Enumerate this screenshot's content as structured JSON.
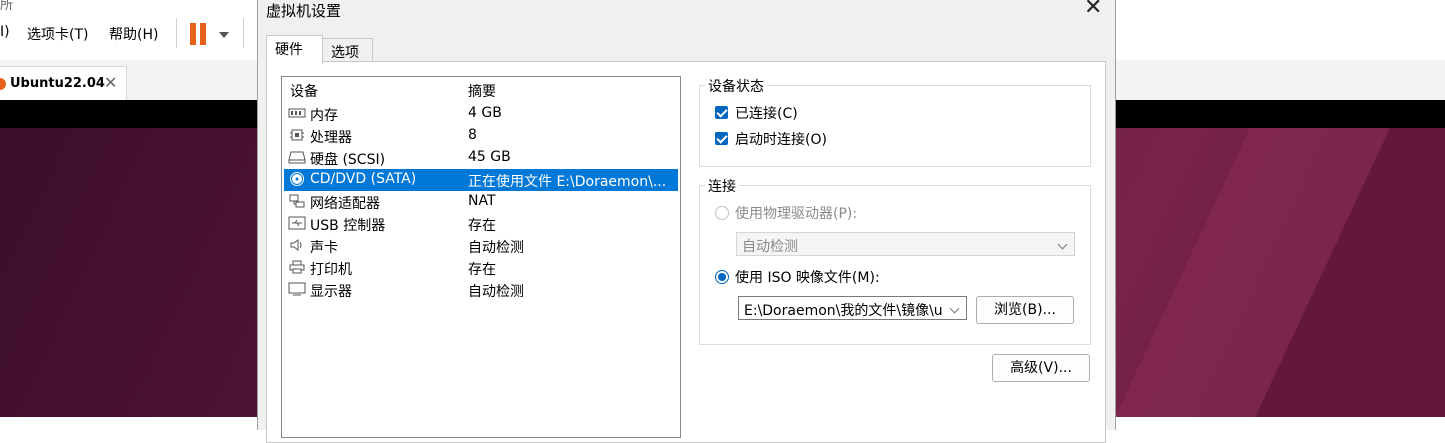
{
  "app": {
    "title_fragment": "所",
    "menu": [
      {
        "label": "I)"
      },
      {
        "label": "选项卡(T)"
      },
      {
        "label": "帮助(H)"
      }
    ],
    "vm_tab": {
      "label": "Ubuntu22.04",
      "close": "✕"
    }
  },
  "dialog": {
    "title": "虚拟机设置",
    "close": "✕",
    "tabs": [
      {
        "label": "硬件"
      },
      {
        "label": "选项"
      }
    ],
    "device_list": {
      "header_device": "设备",
      "header_summary": "摘要",
      "rows": [
        {
          "name": "内存",
          "summary": "4 GB",
          "icon": "memory-icon"
        },
        {
          "name": "处理器",
          "summary": "8",
          "icon": "processor-icon"
        },
        {
          "name": "硬盘 (SCSI)",
          "summary": "45 GB",
          "icon": "harddisk-icon"
        },
        {
          "name": "CD/DVD (SATA)",
          "summary": "正在使用文件 E:\\Doraemon\\...",
          "icon": "cd-dvd-icon"
        },
        {
          "name": "网络适配器",
          "summary": "NAT",
          "icon": "network-adapter-icon"
        },
        {
          "name": "USB 控制器",
          "summary": "存在",
          "icon": "usb-icon"
        },
        {
          "name": "声卡",
          "summary": "自动检测",
          "icon": "speaker-icon"
        },
        {
          "name": "打印机",
          "summary": "存在",
          "icon": "printer-icon"
        },
        {
          "name": "显示器",
          "summary": "自动检测",
          "icon": "monitor-icon"
        }
      ],
      "selected_index": 3
    },
    "device_status": {
      "title": "设备状态",
      "connected": "已连接(C)",
      "connect_at_power_on": "启动时连接(O)"
    },
    "connection": {
      "title": "连接",
      "physical_drive_label": "使用物理驱动器(P):",
      "physical_drive_value": "自动检测",
      "iso_label": "使用 ISO 映像文件(M):",
      "iso_path": "E:\\Doraemon\\我的文件\\镜像\\u",
      "browse": "浏览(B)..."
    },
    "advanced": "高级(V)..."
  }
}
